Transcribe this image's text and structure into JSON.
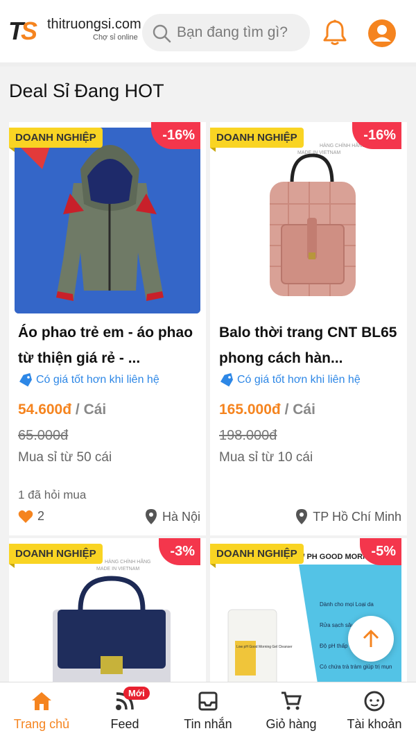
{
  "header": {
    "logo_mark_t": "T",
    "logo_mark_s": "S",
    "logo_name": "thitruongsi",
    "logo_domain": ".com",
    "logo_tagline": "Chợ sỉ online",
    "search_placeholder": "Bạn đang tìm gì?",
    "icons": [
      "search-icon",
      "bell-icon",
      "account-icon"
    ]
  },
  "section": {
    "title": "Deal Sỉ Đang HOT"
  },
  "products": [
    {
      "badge": "DOANH NGHIỆP",
      "discount": "-16%",
      "name": "Áo phao trẻ em - áo phao từ thiện giá rẻ - ...",
      "contact": "Có giá tốt hơn khi liên hệ",
      "price": "54.600đ",
      "unit": " / Cái",
      "old_price": "65.000đ",
      "min_qty": "Mua sỉ từ 50 cái",
      "asked": "1 đã hỏi mua",
      "likes": "2",
      "location": "Hà Nội"
    },
    {
      "badge": "DOANH NGHIỆP",
      "discount": "-16%",
      "name": "Balo thời trang CNT BL65 phong cách hàn...",
      "contact": "Có giá tốt hơn khi liên hệ",
      "price": "165.000đ",
      "unit": " / Cái",
      "old_price": "198.000đ",
      "min_qty": "Mua sỉ từ 10 cái",
      "location": "TP Hồ Chí Minh",
      "image_text": "HÀNG CHÍNH HÃNG",
      "image_subtext": "MADE IN VIETNAM"
    },
    {
      "badge": "DOANH NGHIỆP",
      "discount": "-3%",
      "image_text": "HÀNG CHÍNH HÃNG",
      "image_subtext": "MADE IN VIETNAM"
    },
    {
      "badge": "DOANH NGHIỆP",
      "discount": "-5%",
      "image_text": "W PH GOOD MORN",
      "bullets": [
        "Dành cho mọi Loại da",
        "Rửa sạch sâu",
        "Độ pH thấp",
        "Có chứa trà tràm giúp trị mụn"
      ],
      "tube_text": "Low pH Good Morning Gel Cleanser"
    }
  ],
  "bottom_nav": {
    "items": [
      {
        "label": "Trang chủ",
        "icon": "home-icon"
      },
      {
        "label": "Feed",
        "icon": "feed-icon",
        "badge": "Mới"
      },
      {
        "label": "Tin nhắn",
        "icon": "inbox-icon"
      },
      {
        "label": "Giỏ hàng",
        "icon": "cart-icon"
      },
      {
        "label": "Tài khoản",
        "icon": "profile-icon"
      }
    ]
  },
  "colors": {
    "brand": "#f5841f",
    "badge_yellow": "#f9d423",
    "discount_red": "#f4364c",
    "link_blue": "#2d87e6"
  }
}
